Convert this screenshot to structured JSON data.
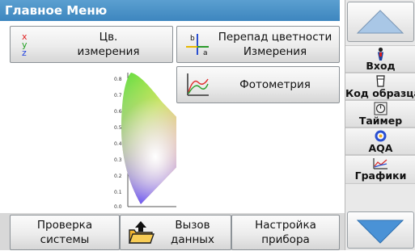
{
  "title": "Главное Меню",
  "buttons": {
    "color_measurement": {
      "line1": "Цв.",
      "line2": "измерения"
    },
    "color_difference": {
      "line1": "Перепад цветности",
      "line2": "Измерения"
    },
    "photometry": {
      "label": "Фотометрия"
    },
    "system_check": {
      "line1": "Проверка",
      "line2": "системы"
    },
    "recall_data": {
      "line1": "Вызов",
      "line2": "данных"
    },
    "instrument_setup": {
      "line1": "Настройка",
      "line2": "прибора"
    }
  },
  "xyz_icon": {
    "x": "x",
    "y": "y",
    "z": "z"
  },
  "diff_icon": {
    "b": "b",
    "a": "a"
  },
  "chart_ticks": [
    "0.8",
    "0.7",
    "0.6",
    "0.5",
    "0.4",
    "0.3",
    "0.2",
    "0.1",
    "0.0"
  ],
  "sidebar": {
    "login": "Вход",
    "sample_id": "Код образца",
    "timer": "Таймер",
    "aqa": "AQA",
    "graphics": "Графики"
  }
}
